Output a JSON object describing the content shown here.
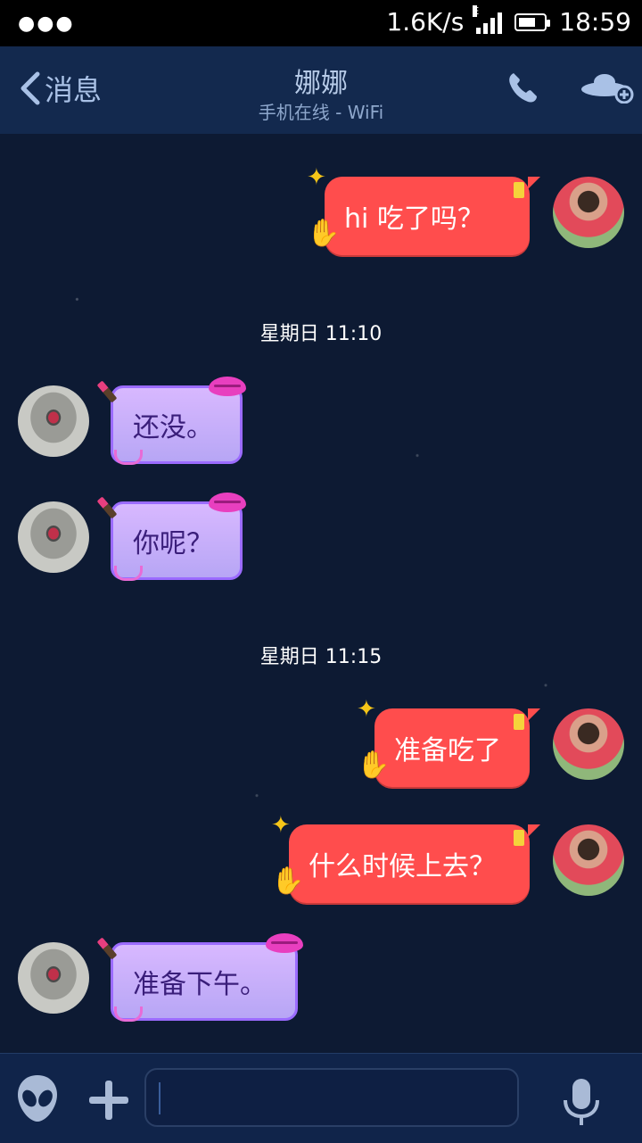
{
  "status_bar": {
    "network_speed": "1.6K/s",
    "network_type": "E",
    "time": "18:59",
    "battery_level": 0.7
  },
  "header": {
    "back_label": "消息",
    "contact_name": "娜娜",
    "contact_status": "手机在线 - WiFi",
    "icons": [
      "back-chevron-icon",
      "phone-icon",
      "ufo-add-icon"
    ]
  },
  "messages": [
    {
      "direction": "out",
      "text": "hi   吃了吗？"
    },
    {
      "type": "timestamp",
      "text": "星期日 11:10"
    },
    {
      "direction": "in",
      "text": "还没。"
    },
    {
      "direction": "in",
      "text": "你呢？"
    },
    {
      "type": "timestamp",
      "text": "星期日 11:15"
    },
    {
      "direction": "out",
      "text": "准备吃了"
    },
    {
      "direction": "out",
      "text": "什么时候上去？"
    },
    {
      "direction": "in",
      "text": "准备下午。"
    }
  ],
  "input_bar": {
    "text_value": "",
    "icons": [
      "alien-emoji-icon",
      "plus-icon",
      "microphone-icon"
    ]
  },
  "colors": {
    "background": "#0b1630",
    "outgoing_bubble": "#ff4d4d",
    "incoming_bubble": "#d8b8ff",
    "incoming_border": "#9b6bff"
  }
}
